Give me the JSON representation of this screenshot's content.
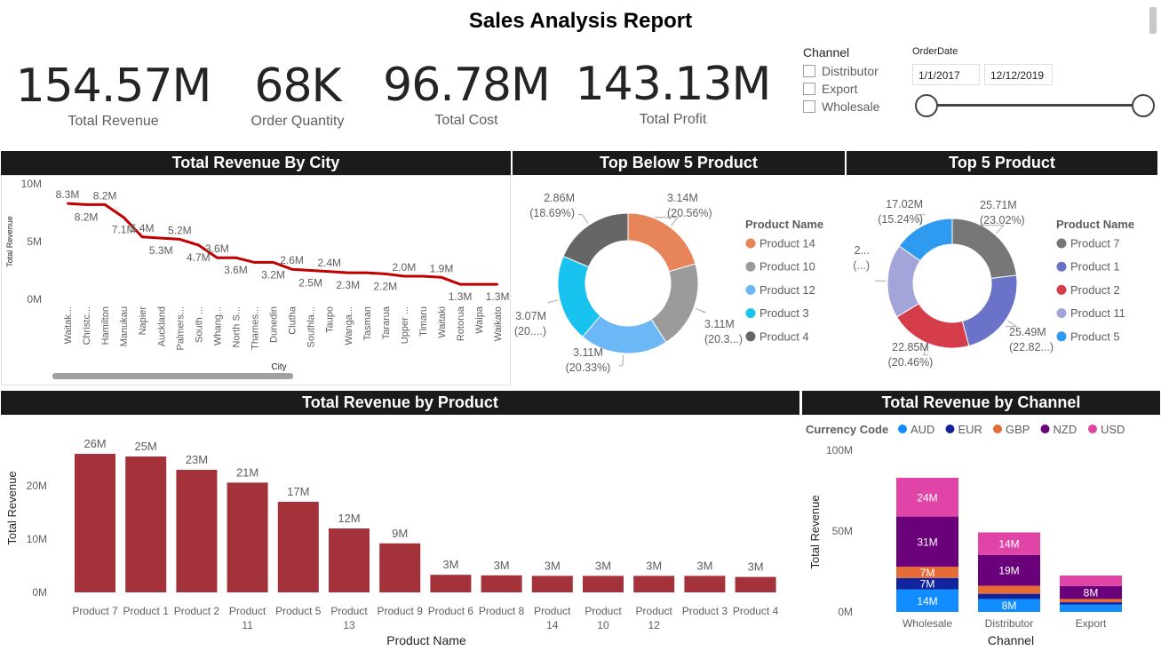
{
  "report": {
    "title": "Sales Analysis Report"
  },
  "kpis": [
    {
      "value": "154.57M",
      "label": "Total Revenue"
    },
    {
      "value": "68K",
      "label": "Order Quantity"
    },
    {
      "value": "96.78M",
      "label": "Total Cost"
    },
    {
      "value": "143.13M",
      "label": "Total Profit"
    }
  ],
  "channel_slicer": {
    "title": "Channel",
    "options": [
      "Distributor",
      "Export",
      "Wholesale"
    ]
  },
  "date_slicer": {
    "title": "OrderDate",
    "start": "1/1/2017",
    "end": "12/12/2019"
  },
  "panels": {
    "city": "Total Revenue By City",
    "below5": "Top Below 5 Product",
    "top5": "Top 5 Product",
    "product": "Total Revenue by Product",
    "channel": "Total Revenue by Channel"
  },
  "chart_data": [
    {
      "id": "city",
      "type": "line",
      "title": "Total Revenue By City",
      "xlabel": "City",
      "ylabel": "Total Revenue",
      "ylim": [
        0,
        10
      ],
      "yticks": [
        "0M",
        "5M",
        "10M"
      ],
      "color": "#c00000",
      "categories": [
        "Waitak...",
        "Christc...",
        "Hamilton",
        "Manukau",
        "Napier",
        "Auckland",
        "Palmers...",
        "South ...",
        "Whang...",
        "North S...",
        "Thames...",
        "Dunedin",
        "Clutha",
        "Southla...",
        "Taupo",
        "Wanga...",
        "Tasman",
        "Tararua",
        "Upper ...",
        "Timaru",
        "Waitaki",
        "Rotorua",
        "Waipa",
        "Waikato"
      ],
      "values": [
        8.3,
        8.2,
        8.2,
        7.1,
        5.4,
        5.3,
        5.2,
        4.7,
        3.6,
        3.6,
        3.2,
        3.2,
        2.6,
        2.5,
        2.4,
        2.3,
        2.3,
        2.2,
        2.0,
        2.0,
        1.9,
        1.3,
        1.3,
        1.3
      ],
      "labels": [
        "8.3M",
        "8.2M",
        "8.2M",
        "7.1M",
        "5.4M",
        "5.3M",
        "5.2M",
        "4.7M",
        "3.6M",
        "3.6M",
        "",
        "3.2M",
        "2.6M",
        "2.5M",
        "2.4M",
        "2.3M",
        "",
        "2.2M",
        "2.0M",
        "",
        "1.9M",
        "1.3M",
        "",
        "1.3M"
      ]
    },
    {
      "id": "below5",
      "type": "pie",
      "title": "Top Below 5 Product",
      "legend_title": "Product Name",
      "slices": [
        {
          "name": "Product 14",
          "value": 3.14,
          "label": "3.14M",
          "pct": "(20.56%)",
          "color": "#e8845a"
        },
        {
          "name": "Product 10",
          "value": 3.11,
          "label": "3.11M",
          "pct": "(20.3...)",
          "color": "#9b9b9b"
        },
        {
          "name": "Product 12",
          "value": 3.11,
          "label": "3.11M",
          "pct": "(20.33%)",
          "color": "#6cb7f5"
        },
        {
          "name": "Product 3",
          "value": 3.07,
          "label": "3.07M",
          "pct": "(20....)",
          "color": "#19c3ef"
        },
        {
          "name": "Product 4",
          "value": 2.86,
          "label": "2.86M",
          "pct": "(18.69%)",
          "color": "#666666"
        }
      ]
    },
    {
      "id": "top5",
      "type": "pie",
      "title": "Top 5 Product",
      "legend_title": "Product Name",
      "slices": [
        {
          "name": "Product 7",
          "value": 25.71,
          "label": "25.71M",
          "pct": "(23.02%)",
          "color": "#777777"
        },
        {
          "name": "Product 1",
          "value": 25.49,
          "label": "25.49M",
          "pct": "(22.82...)",
          "color": "#6a73c8"
        },
        {
          "name": "Product 2",
          "value": 22.85,
          "label": "22.85M",
          "pct": "(20.46%)",
          "color": "#d63d4a"
        },
        {
          "name": "Product 11",
          "value": 20.6,
          "label": "2...",
          "pct": "(...)",
          "color": "#a3a4d9"
        },
        {
          "name": "Product 5",
          "value": 17.02,
          "label": "17.02M",
          "pct": "(15.24%)",
          "color": "#2e9bf0"
        }
      ]
    },
    {
      "id": "product",
      "type": "bar",
      "title": "Total Revenue by Product",
      "xlabel": "Product Name",
      "ylabel": "Total Revenue",
      "ylim": [
        0,
        30
      ],
      "yticks": [
        "0M",
        "10M",
        "20M"
      ],
      "color": "#a4323b",
      "categories": [
        "Product 7",
        "Product 1",
        "Product 2",
        "Product\n11",
        "Product 5",
        "Product\n13",
        "Product 9",
        "Product 6",
        "Product 8",
        "Product\n14",
        "Product\n10",
        "Product\n12",
        "Product 3",
        "Product 4"
      ],
      "values": [
        26,
        25.5,
        23,
        20.6,
        17,
        12,
        9.2,
        3.3,
        3.2,
        3.1,
        3.1,
        3.1,
        3.1,
        2.9
      ],
      "labels": [
        "26M",
        "25M",
        "23M",
        "21M",
        "17M",
        "12M",
        "9M",
        "3M",
        "3M",
        "3M",
        "3M",
        "3M",
        "3M",
        "3M"
      ]
    },
    {
      "id": "channel",
      "type": "bar",
      "stacked": true,
      "title": "Total Revenue by Channel",
      "xlabel": "Channel",
      "ylabel": "Total Revenue",
      "ylim": [
        0,
        100
      ],
      "yticks": [
        "0M",
        "50M",
        "100M"
      ],
      "legend_title": "Currency Code",
      "categories": [
        "Wholesale",
        "Distributor",
        "Export"
      ],
      "series": [
        {
          "name": "AUD",
          "color": "#118dff",
          "values": [
            14,
            8,
            4.5
          ],
          "labels": [
            "14M",
            "8M",
            ""
          ]
        },
        {
          "name": "EUR",
          "color": "#12239e",
          "values": [
            7,
            3.2,
            1.5
          ],
          "labels": [
            "7M",
            "",
            ""
          ]
        },
        {
          "name": "GBP",
          "color": "#e66c37",
          "values": [
            7,
            5,
            2
          ],
          "labels": [
            "7M",
            "",
            ""
          ]
        },
        {
          "name": "NZD",
          "color": "#6b007b",
          "values": [
            31,
            19,
            8
          ],
          "labels": [
            "31M",
            "19M",
            "8M"
          ]
        },
        {
          "name": "USD",
          "color": "#e044a7",
          "values": [
            24,
            14,
            6.5
          ],
          "labels": [
            "24M",
            "14M",
            ""
          ]
        }
      ]
    }
  ]
}
